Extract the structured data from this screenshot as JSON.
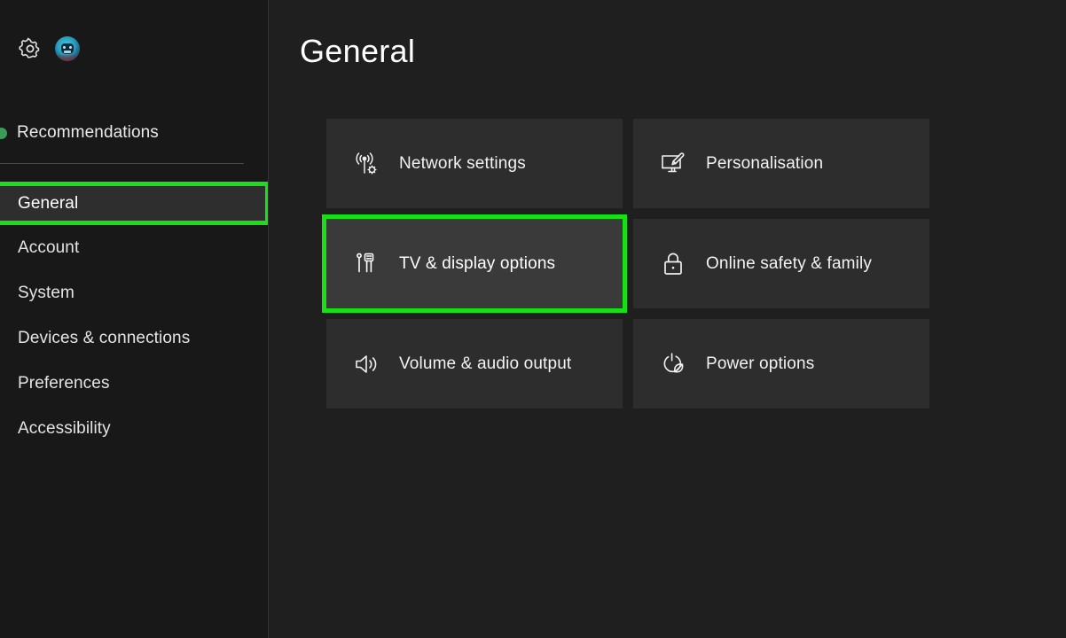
{
  "sidebar": {
    "settings_gear_icon": "gear-icon",
    "avatar_icon": "user-avatar",
    "recommendations": {
      "label": "Recommendations",
      "dot_color": "#3c9b55"
    },
    "items": [
      {
        "label": "General",
        "selected": true
      },
      {
        "label": "Account",
        "selected": false
      },
      {
        "label": "System",
        "selected": false
      },
      {
        "label": "Devices & connections",
        "selected": false
      },
      {
        "label": "Preferences",
        "selected": false
      },
      {
        "label": "Accessibility",
        "selected": false
      }
    ]
  },
  "main": {
    "title": "General",
    "tiles": [
      {
        "label": "Network settings",
        "icon": "network-antenna-gear-icon",
        "highlighted": false
      },
      {
        "label": "Personalisation",
        "icon": "monitor-brush-icon",
        "highlighted": false
      },
      {
        "label": "TV & display options",
        "icon": "hdmi-plug-icon",
        "highlighted": true
      },
      {
        "label": "Online safety & family",
        "icon": "lock-icon",
        "highlighted": false
      },
      {
        "label": "Volume & audio output",
        "icon": "speaker-icon",
        "highlighted": false
      },
      {
        "label": "Power options",
        "icon": "power-leaf-icon",
        "highlighted": false
      }
    ]
  },
  "colors": {
    "highlight_green": "#17e017",
    "background": "#1f1f1f",
    "sidebar_background": "#181818",
    "tile_background": "#2d2d2d",
    "tile_highlighted_background": "#3a3a3a"
  }
}
